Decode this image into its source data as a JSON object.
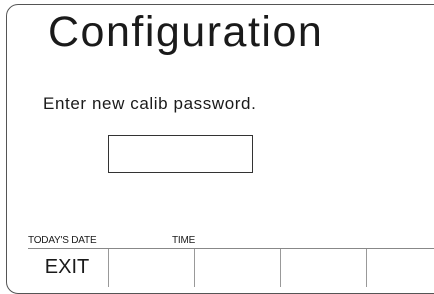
{
  "screen": {
    "title": "Configuration",
    "prompt": "Enter new calib password.",
    "password_value": ""
  },
  "status_bar": {
    "date_label": "TODAY'S DATE",
    "time_label": "TIME"
  },
  "softkeys": [
    "EXIT",
    "",
    "",
    "",
    ""
  ]
}
